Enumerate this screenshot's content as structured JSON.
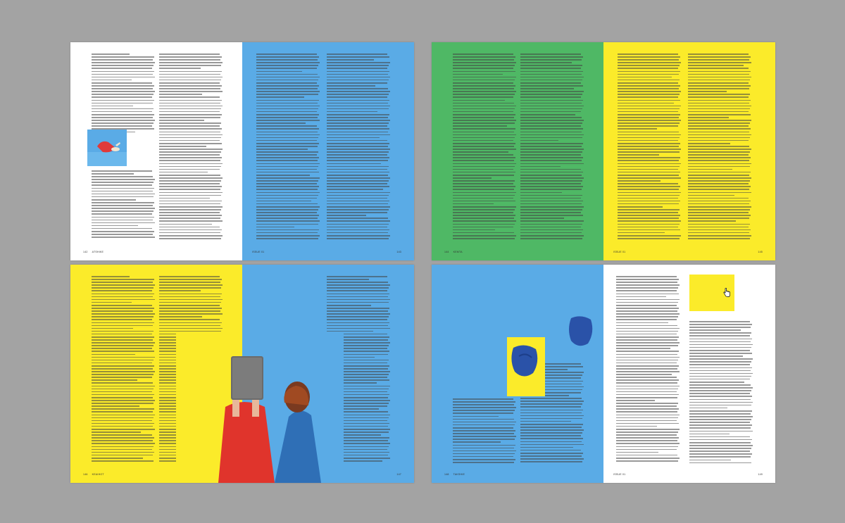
{
  "spreads": [
    {
      "left_page": {
        "folio_number": "142",
        "folio_title": "ATSHIKE"
      },
      "right_page": {
        "folio_issue": "ISSUE 01",
        "folio_number": "143"
      },
      "colors": {
        "left": "#ffffff",
        "right": "#5aabe6"
      }
    },
    {
      "left_page": {
        "folio_number": "144",
        "folio_title": "KEMTA"
      },
      "right_page": {
        "folio_issue": "ISSUE 01",
        "folio_number": "145"
      },
      "colors": {
        "left": "#4fb865",
        "right": "#fbeb2a"
      }
    },
    {
      "left_page": {
        "folio_number": "146",
        "folio_title": "KEAIHOT"
      },
      "right_page": {
        "folio_issue": "ISSUE 01",
        "folio_number": "147"
      },
      "colors": {
        "left": "#fbeb2a",
        "right": "#5aabe6"
      }
    },
    {
      "left_page": {
        "folio_number": "148",
        "folio_title": "TAKSHIE"
      },
      "right_page": {
        "folio_issue": "ISSUE 01",
        "folio_number": "149"
      },
      "colors": {
        "left": "#5aabe6",
        "right": "#ffffff"
      }
    }
  ],
  "icons": {
    "cursor": "hand-pointer-icon"
  }
}
